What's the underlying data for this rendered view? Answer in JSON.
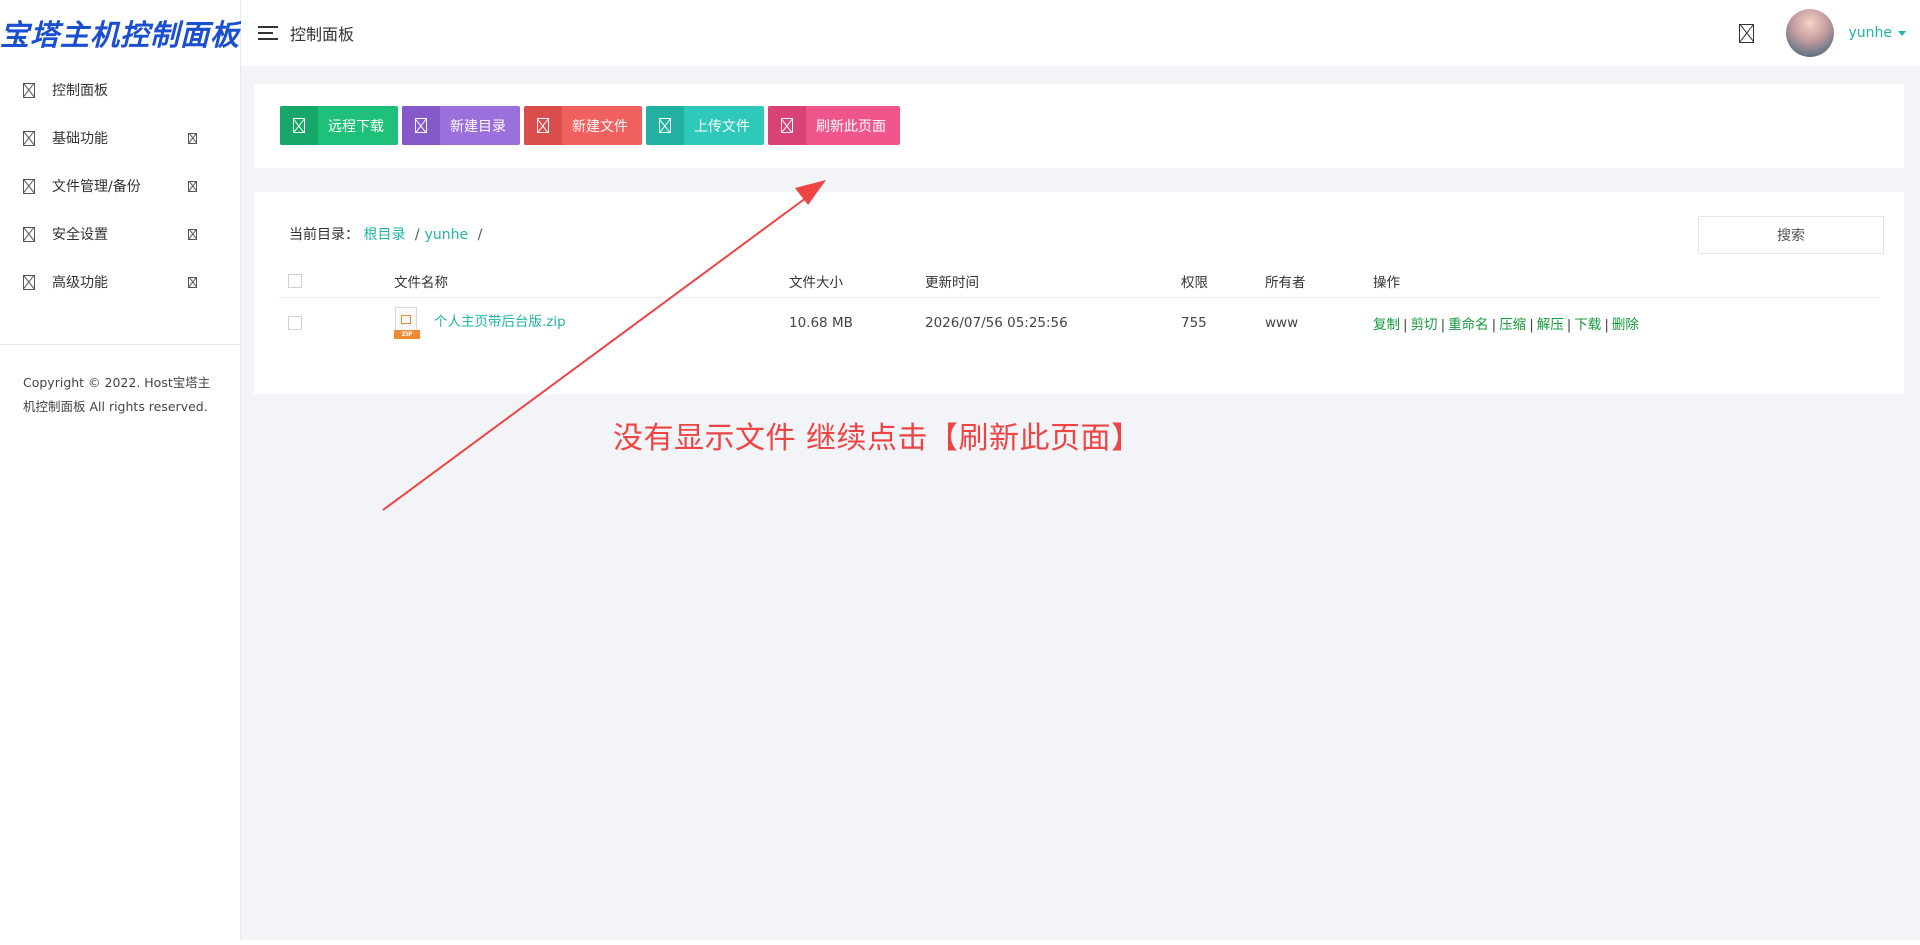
{
  "logo": {
    "text": "宝塔主机控制面板"
  },
  "header": {
    "title": "控制面板",
    "username": "yunhe"
  },
  "sidebar": {
    "items": [
      {
        "label": "控制面板",
        "icon": "dashboard-icon",
        "has_arrow": false
      },
      {
        "label": "基础功能",
        "icon": "basic-icon",
        "has_arrow": true
      },
      {
        "label": "文件管理/备份",
        "icon": "folder-icon",
        "has_arrow": true
      },
      {
        "label": "安全设置",
        "icon": "shield-icon",
        "has_arrow": true
      },
      {
        "label": "高级功能",
        "icon": "advanced-icon",
        "has_arrow": true
      }
    ],
    "copyright_line1": "Copyright © 2022. Host宝塔主",
    "copyright_line2": "机控制面板 All rights reserved."
  },
  "toolbar": {
    "buttons": [
      {
        "label": "远程下载",
        "color": "#1ec07a",
        "icon_bg": "#17a869"
      },
      {
        "label": "新建目录",
        "color": "#9b6fdc",
        "icon_bg": "#8559c9"
      },
      {
        "label": "新建文件",
        "color": "#f0605f",
        "icon_bg": "#d94e4d"
      },
      {
        "label": "上传文件",
        "color": "#2ec9b8",
        "icon_bg": "#22b0a1"
      },
      {
        "label": "刷新此页面",
        "color": "#f0568c",
        "icon_bg": "#d94277"
      }
    ]
  },
  "breadcrumb": {
    "prefix": "当前目录：",
    "root": "根目录",
    "folder": "yunhe",
    "sep": "/"
  },
  "search": {
    "label": "搜索"
  },
  "table": {
    "columns": {
      "name": "文件名称",
      "size": "文件大小",
      "time": "更新时间",
      "perm": "权限",
      "owner": "所有者",
      "ops": "操作"
    },
    "rows": [
      {
        "name": "个人主页带后台版.zip",
        "size": "10.68 MB",
        "time": "2026/07/56 05:25:56",
        "perm": "755",
        "owner": "www",
        "icon_label": "ZIP"
      }
    ],
    "actions": [
      "复制",
      "剪切",
      "重命名",
      "压缩",
      "解压",
      "下载",
      "删除"
    ]
  },
  "annotation": {
    "text": "没有显示文件 继续点击【刷新此页面】",
    "color": "#ee4444"
  }
}
